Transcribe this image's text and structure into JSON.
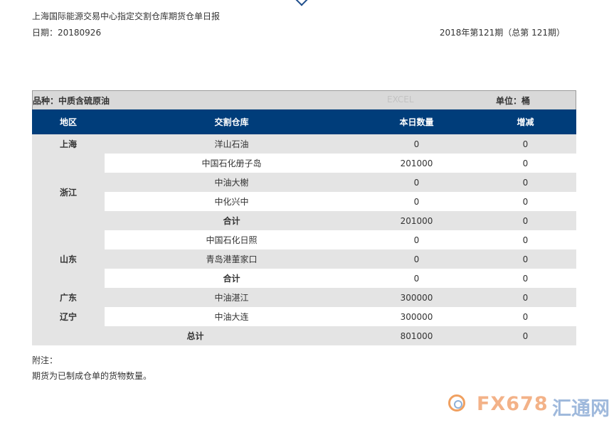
{
  "header": {
    "title": "上海国际能源交易中心指定交割仓库期货仓单日报",
    "date_label": "日期：20180926",
    "issue": "2018年第121期（总第 121期）"
  },
  "meta": {
    "variety": "品种：中质含硫原油",
    "excel": "EXCEL",
    "unit": "单位：桶"
  },
  "columns": [
    "地区",
    "交割仓库",
    "本日数量",
    "增减"
  ],
  "regions": {
    "shanghai": "上海",
    "zhejiang": "浙江",
    "shandong": "山东",
    "guangdong": "广东",
    "liaoning": "辽宁"
  },
  "rows": [
    {
      "warehouse": "洋山石油",
      "qty": "0",
      "change": "0"
    },
    {
      "warehouse": "中国石化册子岛",
      "qty": "201000",
      "change": "0"
    },
    {
      "warehouse": "中油大榭",
      "qty": "0",
      "change": "0"
    },
    {
      "warehouse": "中化兴中",
      "qty": "0",
      "change": "0"
    },
    {
      "warehouse": "合计",
      "qty": "201000",
      "change": "0"
    },
    {
      "warehouse": "中国石化日照",
      "qty": "0",
      "change": "0"
    },
    {
      "warehouse": "青岛港董家口",
      "qty": "0",
      "change": "0"
    },
    {
      "warehouse": "合计",
      "qty": "0",
      "change": "0"
    },
    {
      "warehouse": "中油湛江",
      "qty": "300000",
      "change": "0"
    },
    {
      "warehouse": "中油大连",
      "qty": "300000",
      "change": "0"
    }
  ],
  "total": {
    "label": "总计",
    "qty": "801000",
    "change": "0"
  },
  "notes": {
    "label": "附注：",
    "text": "期货为已制成仓单的货物数量。"
  },
  "watermark": {
    "latin": "FX678",
    "cn": "汇通网"
  }
}
